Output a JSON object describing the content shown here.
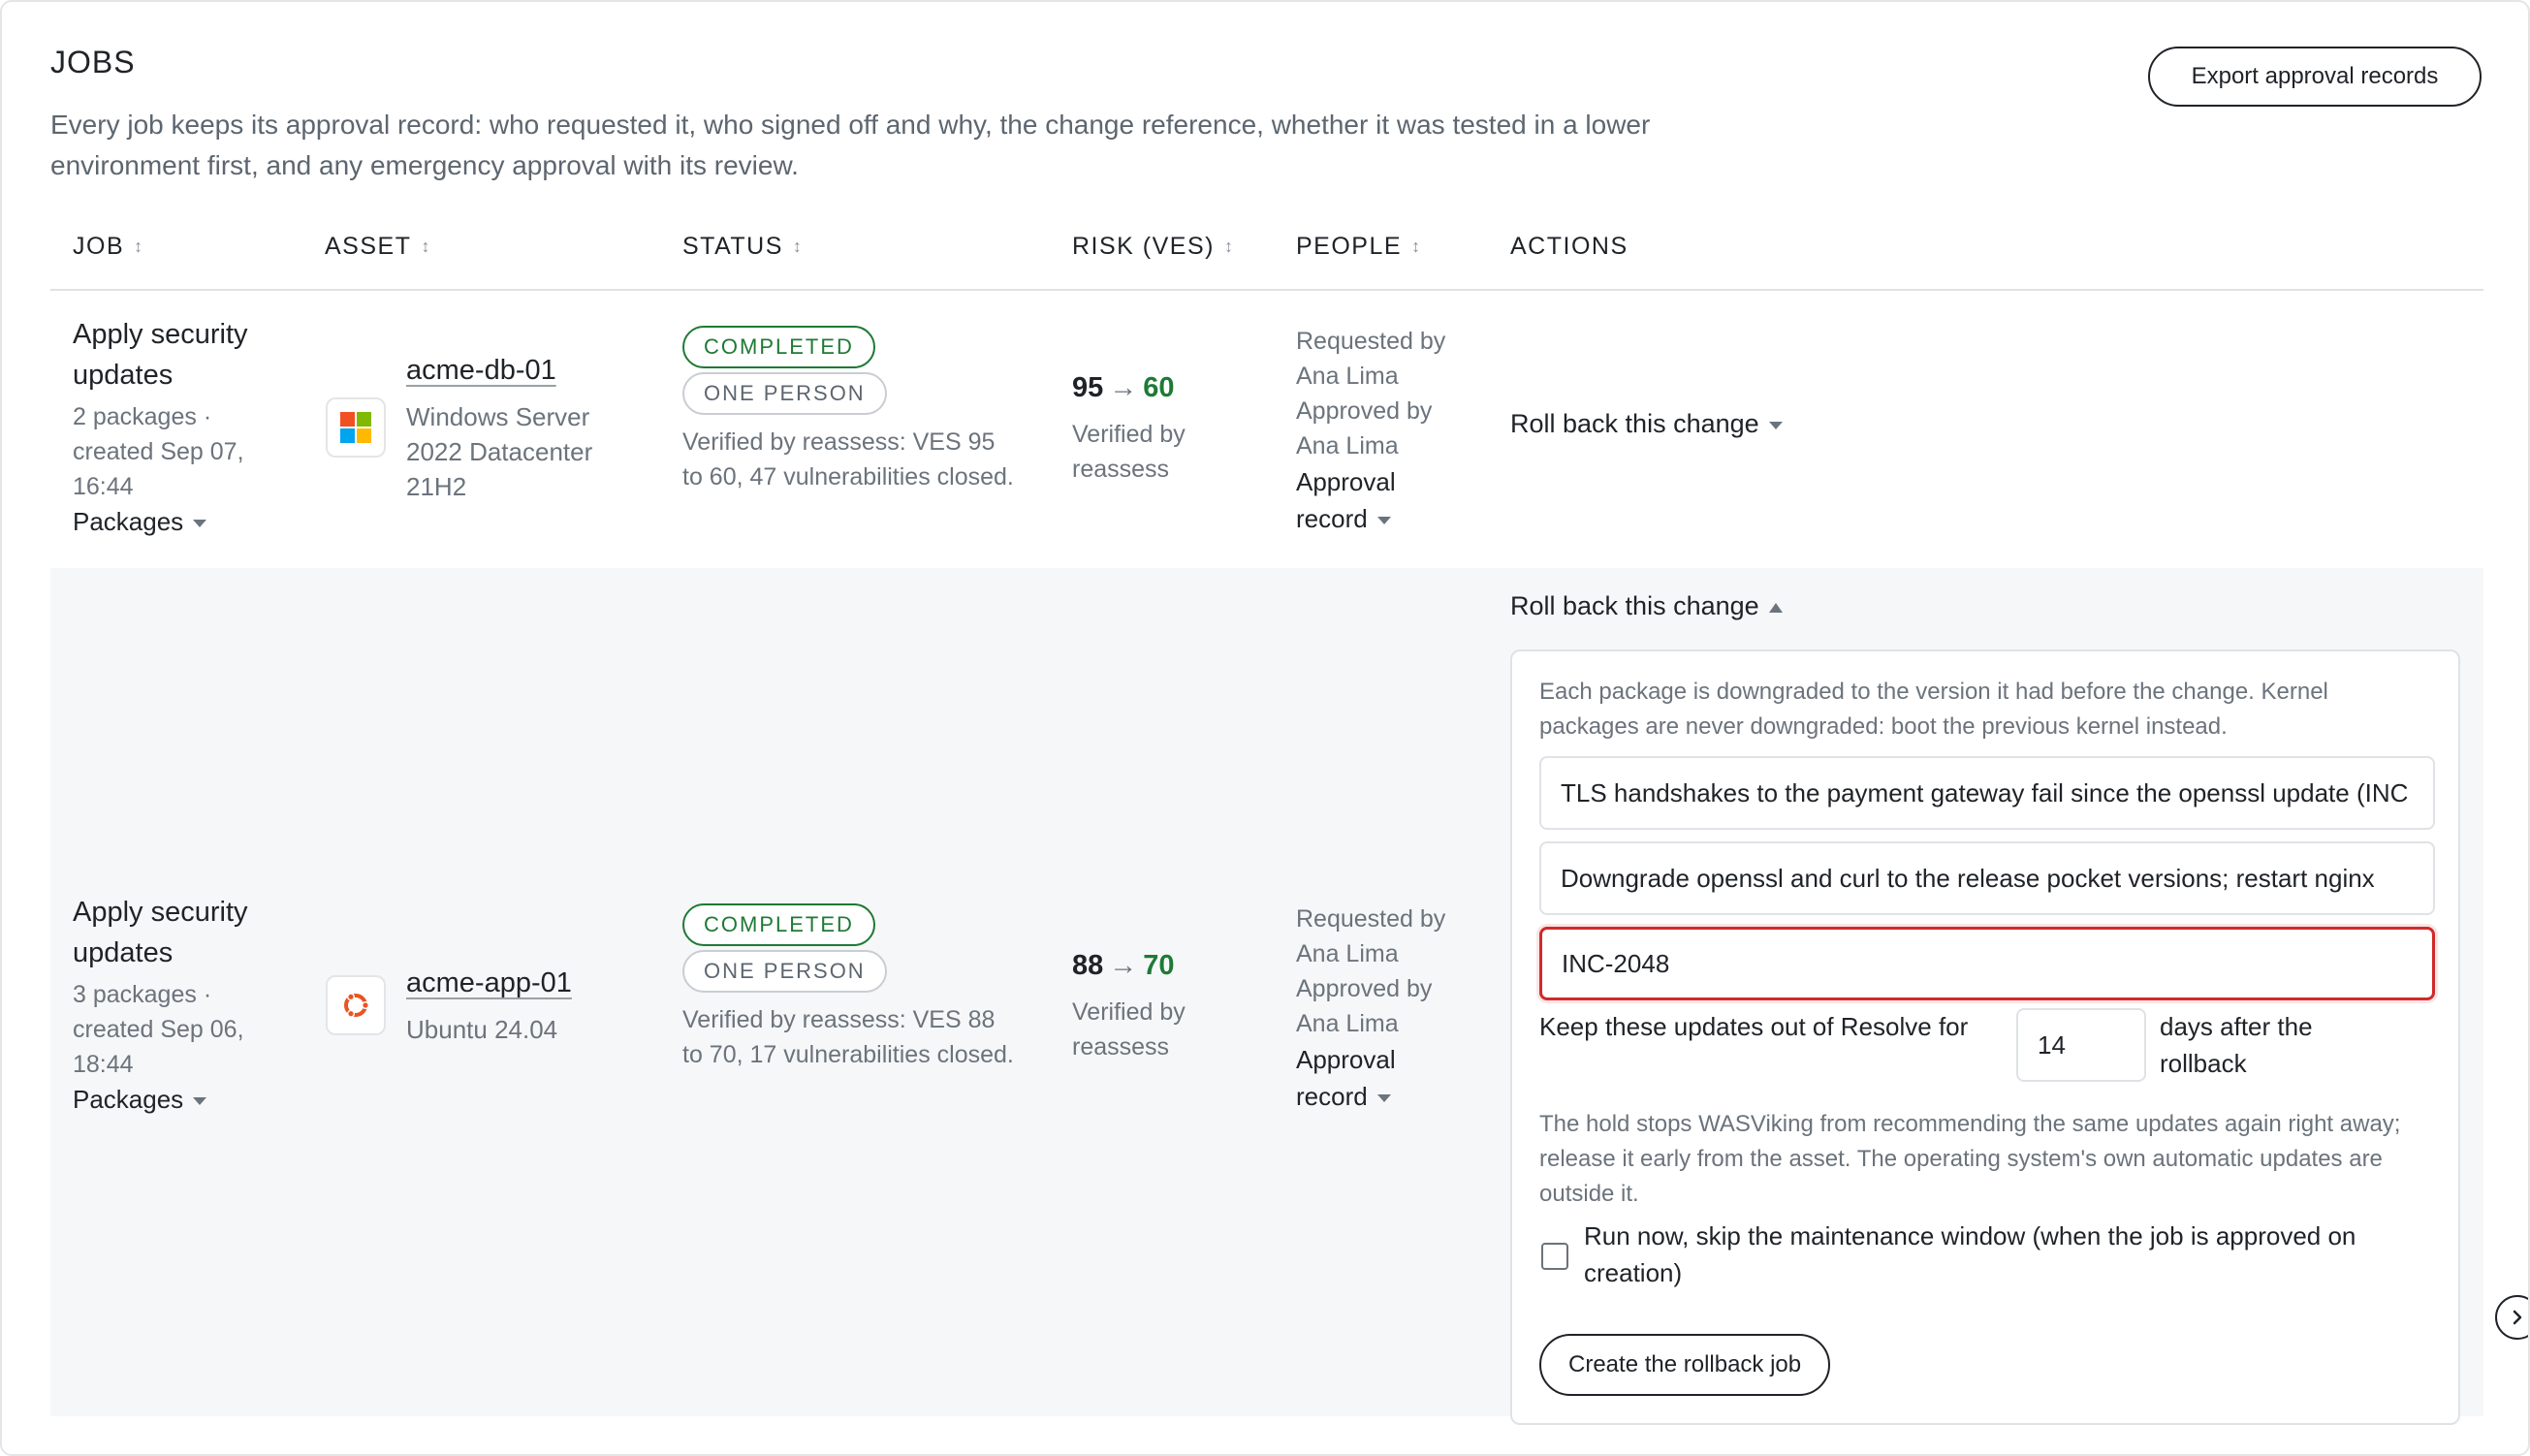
{
  "header": {
    "title": "JOBS",
    "description": "Every job keeps its approval record: who requested it, who signed off and why, the change reference, whether it was tested in a lower environment first, and any emergency approval with its review.",
    "export_label": "Export approval records"
  },
  "columns": {
    "job": "JOB",
    "asset": "ASSET",
    "status": "STATUS",
    "risk": "RISK (VES)",
    "people": "PEOPLE",
    "actions": "ACTIONS"
  },
  "rows": [
    {
      "job_title": "Apply security updates",
      "job_meta": "2 packages · created Sep 07, 16:44",
      "packages_label": "Packages",
      "asset_name": "acme-db-01",
      "asset_os": "Windows Server 2022 Datacenter 21H2",
      "asset_icon": "windows-logo-icon",
      "status_badge": "COMPLETED",
      "approval_badge": "ONE PERSON",
      "status_note": "Verified by reassess: VES 95 to 60, 47 vulnerabilities closed.",
      "risk_before": "95",
      "risk_arrow": "→",
      "risk_after": "60",
      "risk_note": "Verified by reassess",
      "requested_by_label": "Requested by",
      "requested_by": "Ana Lima",
      "approved_by_label": "Approved by",
      "approved_by": "Ana Lima",
      "approval_record_label": "Approval record",
      "action_label": "Roll back this change"
    },
    {
      "job_title": "Apply security updates",
      "job_meta": "3 packages · created Sep 06, 18:44",
      "packages_label": "Packages",
      "asset_name": "acme-app-01",
      "asset_os": "Ubuntu 24.04",
      "asset_icon": "ubuntu-logo-icon",
      "status_badge": "COMPLETED",
      "approval_badge": "ONE PERSON",
      "status_note": "Verified by reassess: VES 88 to 70, 17 vulnerabilities closed.",
      "risk_before": "88",
      "risk_arrow": "→",
      "risk_after": "70",
      "risk_note": "Verified by reassess",
      "requested_by_label": "Requested by",
      "requested_by": "Ana Lima",
      "approved_by_label": "Approved by",
      "approved_by": "Ana Lima",
      "approval_record_label": "Approval record",
      "action_label": "Roll back this change"
    }
  ],
  "rollback": {
    "intro": "Each package is downgraded to the version it had before the change. Kernel packages are never downgraded: boot the previous kernel instead.",
    "reason_value": "TLS handshakes to the payment gateway fail since the openssl update (INC",
    "plan_value": "Downgrade openssl and curl to the release pocket versions; restart nginx",
    "reference_value": "INC-2048",
    "hold_label_before": "Keep these updates out of Resolve for",
    "hold_days": "14",
    "hold_label_after": "days after the rollback",
    "hold_note": "The hold stops WASViking from recommending the same updates again right away; release it early from the asset. The operating system's own automatic updates are outside it.",
    "run_now_label": "Run now, skip the maintenance window (when the job is approved on creation)",
    "run_now_checked": false,
    "create_label": "Create the rollback job"
  },
  "colors": {
    "accent_green": "#1e7a35",
    "error_red": "#d02a2a",
    "text": "#1f2328",
    "muted": "#6b737c"
  }
}
